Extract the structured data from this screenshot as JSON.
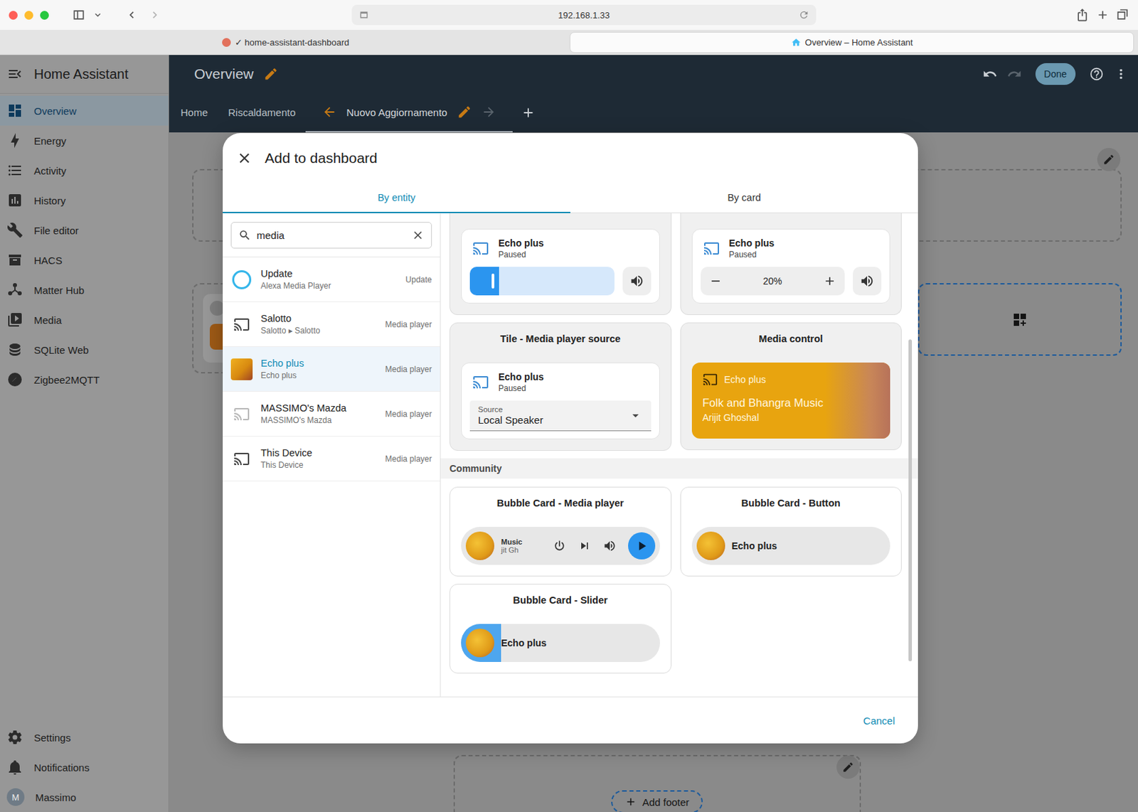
{
  "browser": {
    "address": "192.168.1.33",
    "tabs": [
      {
        "label": "✓ home-assistant-dashboard",
        "selected": false
      },
      {
        "label": "Overview – Home Assistant",
        "selected": true
      }
    ]
  },
  "sidebar": {
    "title": "Home Assistant",
    "items": [
      {
        "label": "Overview",
        "selected": true
      },
      {
        "label": "Energy",
        "selected": false
      },
      {
        "label": "Activity",
        "selected": false
      },
      {
        "label": "History",
        "selected": false
      },
      {
        "label": "File editor",
        "selected": false
      },
      {
        "label": "HACS",
        "selected": false
      },
      {
        "label": "Matter Hub",
        "selected": false
      },
      {
        "label": "Media",
        "selected": false
      },
      {
        "label": "SQLite Web",
        "selected": false
      },
      {
        "label": "Zigbee2MQTT",
        "selected": false
      }
    ],
    "bottom_items": [
      {
        "label": "Settings"
      },
      {
        "label": "Notifications"
      }
    ],
    "user": {
      "initial": "M",
      "name": "Massimo"
    }
  },
  "header": {
    "title": "Overview",
    "done": "Done",
    "tabs": [
      {
        "label": "Home",
        "selected": false
      },
      {
        "label": "Riscaldamento",
        "selected": false
      },
      {
        "label": "Nuovo Aggiornamento",
        "selected": true
      }
    ]
  },
  "dashboard": {
    "footer_button": "Add footer"
  },
  "dialog": {
    "title": "Add to dashboard",
    "tabs": [
      {
        "label": "By entity",
        "selected": true
      },
      {
        "label": "By card",
        "selected": false
      }
    ],
    "search": {
      "value": "media"
    },
    "entities": [
      {
        "name": "Update",
        "sub": "Alexa Media Player",
        "type": "Update",
        "selected": false,
        "kind": "update"
      },
      {
        "name": "Salotto",
        "sub": "Salotto ▸ Salotto",
        "type": "Media player",
        "selected": false,
        "kind": "cast"
      },
      {
        "name": "Echo plus",
        "sub": "Echo plus",
        "type": "Media player",
        "selected": true,
        "kind": "artwork"
      },
      {
        "name": "MASSIMO's Mazda",
        "sub": "MASSIMO's Mazda",
        "type": "Media player",
        "selected": false,
        "kind": "cast-off"
      },
      {
        "name": "This Device",
        "sub": "This Device",
        "type": "Media player",
        "selected": false,
        "kind": "cast"
      }
    ],
    "partial_cards": [
      {
        "kind": "slider",
        "name": "Echo plus",
        "state": "Paused",
        "level": 0.2
      },
      {
        "kind": "stepper",
        "name": "Echo plus",
        "state": "Paused",
        "value": "20%"
      }
    ],
    "source_card": {
      "title": "Tile - Media player source",
      "name": "Echo plus",
      "state": "Paused",
      "field_label": "Source",
      "field_value": "Local Speaker"
    },
    "media_card": {
      "title": "Media control",
      "name": "Echo plus",
      "track": "Folk and Bhangra Music",
      "artist": "Arijit Ghoshal"
    },
    "community_label": "Community",
    "community_cards": [
      {
        "title": "Bubble Card - Media player",
        "kind": "media",
        "line1": "Music",
        "line2": "jit Gh"
      },
      {
        "title": "Bubble Card - Button",
        "kind": "button",
        "name": "Echo plus"
      },
      {
        "title": "Bubble Card - Slider",
        "kind": "slider",
        "name": "Echo plus",
        "level": 0.2
      }
    ],
    "cancel": "Cancel"
  }
}
